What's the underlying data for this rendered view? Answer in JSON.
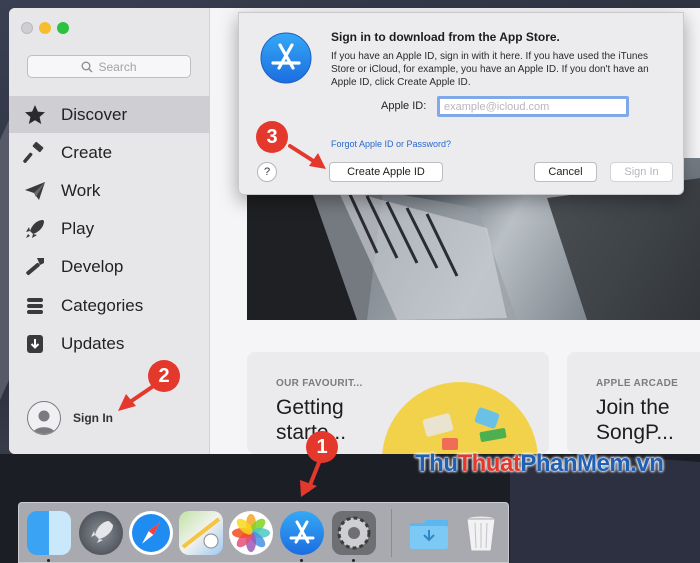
{
  "sidebar": {
    "search_placeholder": "Search",
    "items": [
      {
        "label": "Discover",
        "icon": "star-icon",
        "active": true
      },
      {
        "label": "Create",
        "icon": "hammer-icon",
        "active": false
      },
      {
        "label": "Work",
        "icon": "paper-plane-icon",
        "active": false
      },
      {
        "label": "Play",
        "icon": "rocket-icon",
        "active": false
      },
      {
        "label": "Develop",
        "icon": "wrench-icon",
        "active": false
      },
      {
        "label": "Categories",
        "icon": "stack-icon",
        "active": false
      },
      {
        "label": "Updates",
        "icon": "download-icon",
        "active": false
      }
    ],
    "sign_in_label": "Sign In"
  },
  "dialog": {
    "title": "Sign in to download from the App Store.",
    "body": "If you have an Apple ID, sign in with it here. If you have used the iTunes Store or iCloud, for example, you have an Apple ID. If you don't have an Apple ID, click Create Apple ID.",
    "apple_id_label": "Apple ID:",
    "apple_id_placeholder": "example@icloud.com",
    "forgot_link": "Forgot Apple ID or Password?",
    "help_label": "?",
    "create_button": "Create Apple ID",
    "cancel_button": "Cancel",
    "signin_button": "Sign In"
  },
  "cards": [
    {
      "kicker": "OUR FAVOURIT...",
      "title_line1": "Getting",
      "title_line2": "starte..."
    },
    {
      "kicker": "APPLE ARCADE",
      "title_line1": "Join the",
      "title_line2": "SongP..."
    }
  ],
  "dock": {
    "apps": [
      "finder-icon",
      "launchpad-icon",
      "safari-icon",
      "maps-icon",
      "photos-icon",
      "app-store-icon",
      "system-preferences-icon",
      "downloads-folder-icon",
      "trash-icon"
    ]
  },
  "annotations": {
    "step1": "1",
    "step2": "2",
    "step3": "3",
    "accent_color": "#e4382c"
  },
  "watermark": {
    "part1": "Thu",
    "part2": "Thuat",
    "part3": "PhanMem",
    "part4": ".vn"
  }
}
